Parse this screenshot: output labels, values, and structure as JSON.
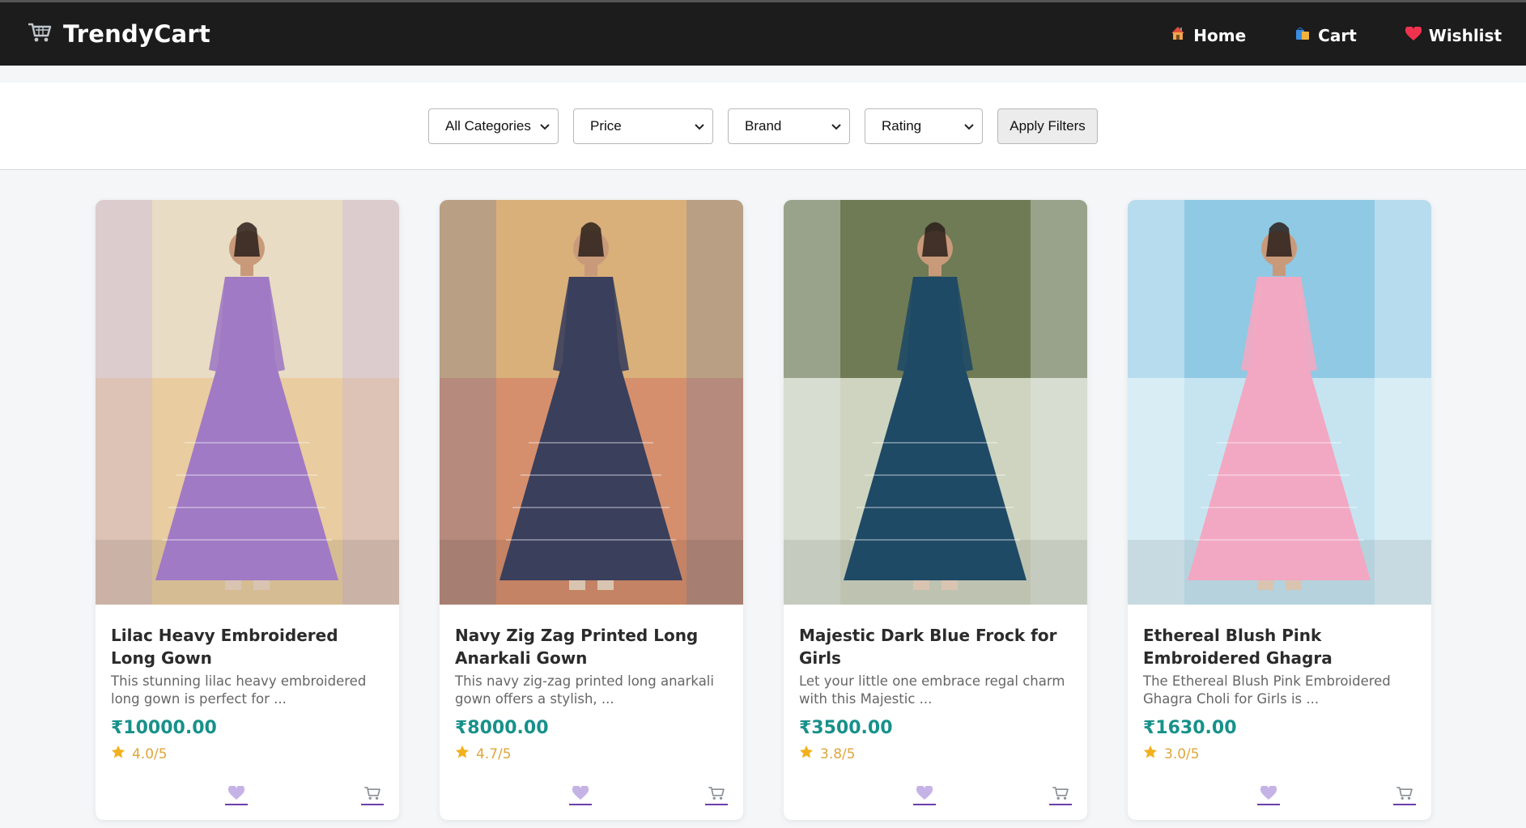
{
  "header": {
    "brand": "TrendyCart",
    "nav": [
      {
        "label": "Home",
        "icon": "home-icon"
      },
      {
        "label": "Cart",
        "icon": "shopping-bags-icon"
      },
      {
        "label": "Wishlist",
        "icon": "heart-icon"
      }
    ]
  },
  "filters": {
    "category": "All Categories",
    "price": "Price",
    "brand": "Brand",
    "rating": "Rating",
    "apply_label": "Apply Filters"
  },
  "products": [
    {
      "title": "Lilac Heavy Embroidered Long Gown",
      "description": "This stunning lilac heavy embroidered long gown is perfect for ...",
      "price": "₹10000.00",
      "rating": "4.0/5",
      "image_colors": {
        "sky": "#e8dcc4",
        "bg": "#e9c99a",
        "garment": "#a07ac4",
        "accent": "#c9b0df"
      }
    },
    {
      "title": "Navy Zig Zag Printed Long Anarkali Gown",
      "description": "This navy zig-zag printed long anarkali gown offers a stylish, ...",
      "price": "₹8000.00",
      "rating": "4.7/5",
      "image_colors": {
        "sky": "#d9b07a",
        "bg": "#d38a6b",
        "garment": "#3a3f5c",
        "accent": "#7d8199"
      }
    },
    {
      "title": "Majestic Dark Blue Frock for Girls",
      "description": "Let your little one embrace regal charm with this Majestic ...",
      "price": "₹3500.00",
      "rating": "3.8/5",
      "image_colors": {
        "sky": "#6f7b55",
        "bg": "#dfe4d2",
        "garment": "#1f4a66",
        "accent": "#e8eef0"
      }
    },
    {
      "title": "Ethereal Blush Pink Embroidered Ghagra",
      "description": "The Ethereal Blush Pink Embroidered Ghagra Choli for Girls is ...",
      "price": "₹1630.00",
      "rating": "3.0/5",
      "image_colors": {
        "sky": "#8fc9e4",
        "bg": "#cfe9f2",
        "garment": "#f2a8c2",
        "accent": "#ffffff"
      }
    }
  ],
  "colors": {
    "header_bg": "#1c1c1c",
    "price": "#17918a",
    "rating": "#e0a63c",
    "action_underline": "#6c3eaa"
  }
}
